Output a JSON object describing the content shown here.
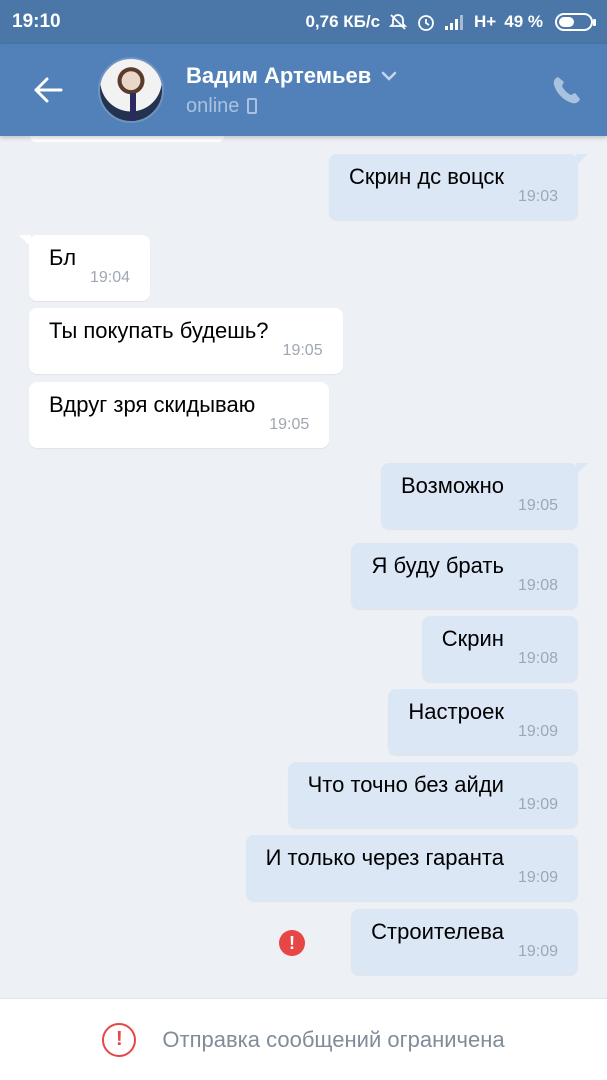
{
  "status_bar": {
    "time": "19:10",
    "speed": "0,76 КБ/с",
    "network": "H+",
    "battery": "49 %",
    "battery_level": 0.49
  },
  "header": {
    "contact_name": "Вадим Артемьев",
    "status": "online",
    "accent_color": "#5181b8"
  },
  "messages": [
    {
      "direction": "out",
      "text": "Скрин дс воцск",
      "time": "19:03"
    },
    {
      "direction": "in",
      "text": "Бл",
      "time": "19:04"
    },
    {
      "direction": "in",
      "text": "Ты покупать будешь?",
      "time": "19:05"
    },
    {
      "direction": "in",
      "text": "Вдруг зря скидываю",
      "time": "19:05"
    },
    {
      "direction": "out",
      "text": "Возможно",
      "time": "19:05"
    },
    {
      "direction": "out",
      "text": "Я буду брать",
      "time": "19:08"
    },
    {
      "direction": "out",
      "text": "Скрин",
      "time": "19:08"
    },
    {
      "direction": "out",
      "text": "Настроек",
      "time": "19:09"
    },
    {
      "direction": "out",
      "text": "Что точно без айди",
      "time": "19:09"
    },
    {
      "direction": "out",
      "text": "И только через гаранта",
      "time": "19:09"
    },
    {
      "direction": "out",
      "text": "Строителева",
      "time": "19:09",
      "failed": true
    }
  ],
  "footer": {
    "notice": "Отправка сообщений ограничена",
    "icon": "exclamation-circle-icon",
    "color": "#e64646"
  }
}
